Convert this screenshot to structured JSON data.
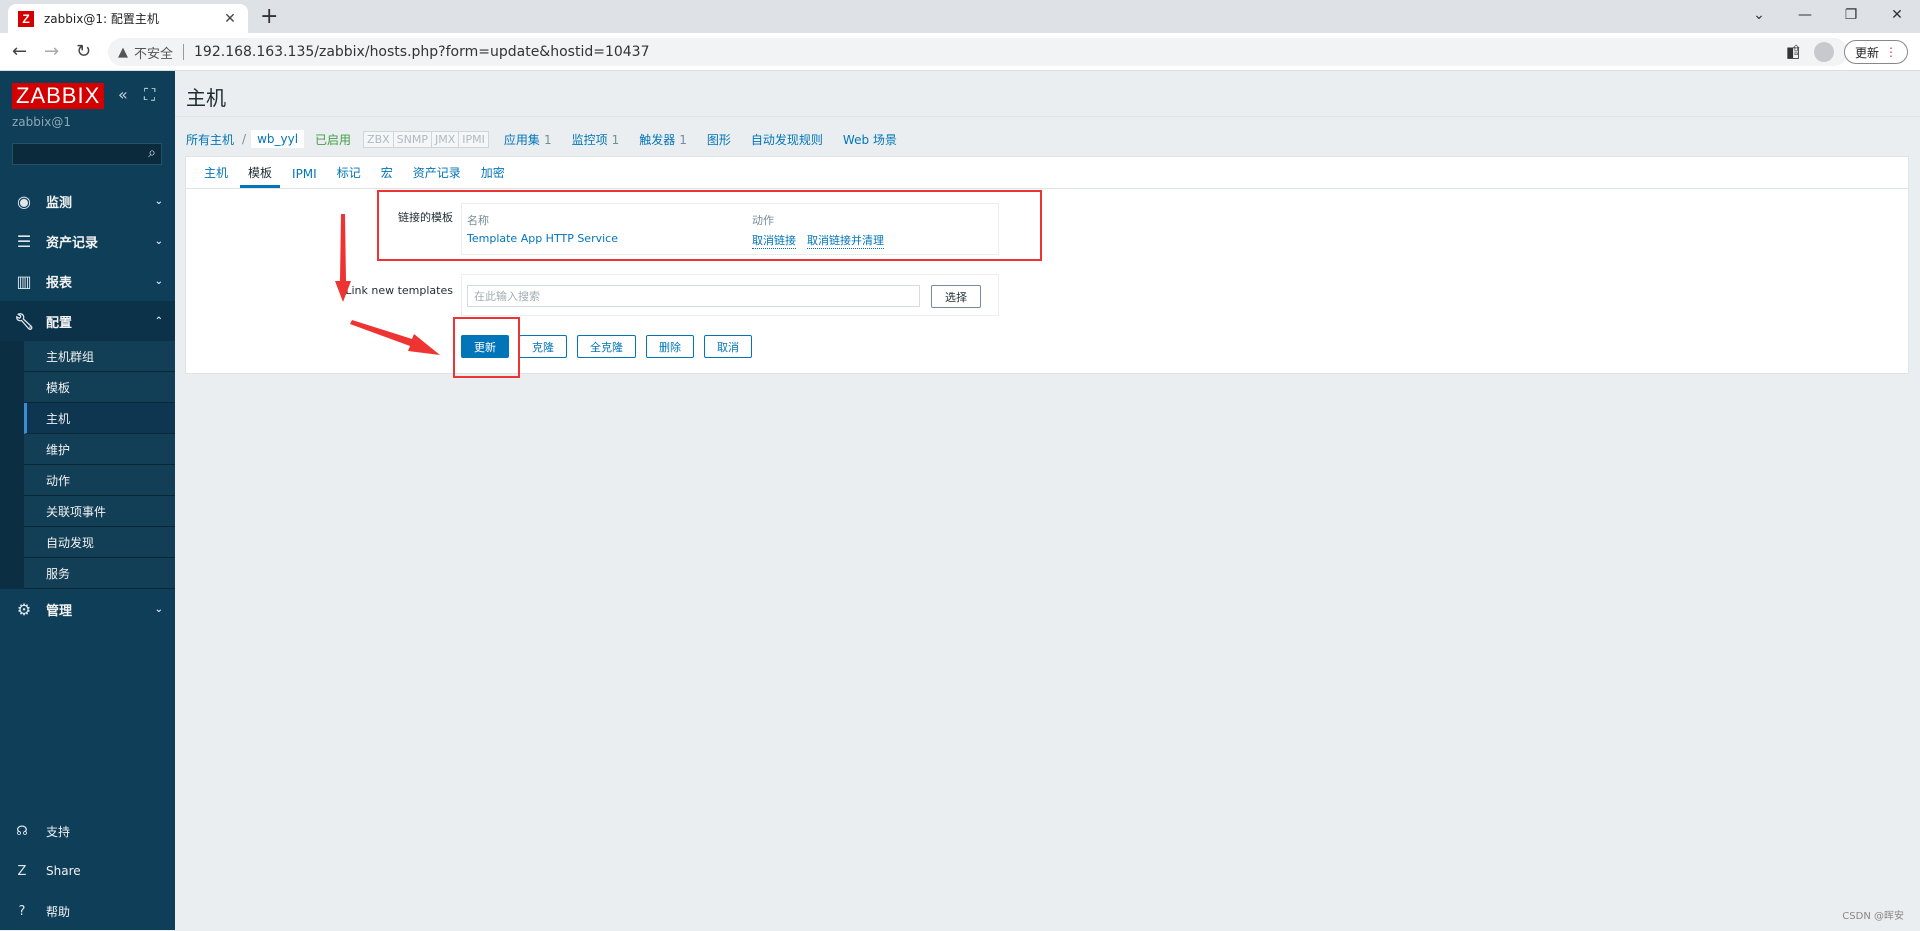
{
  "browser": {
    "tab_title": "zabbix@1: 配置主机",
    "favicon_letter": "Z",
    "insecure_label": "不安全",
    "url": "192.168.163.135/zabbix/hosts.php?form=update&hostid=10437",
    "update_label": "更新"
  },
  "sidebar": {
    "logo": "ZABBIX",
    "user": "zabbix@1",
    "menu": [
      {
        "label": "监测",
        "icon": "eye-icon"
      },
      {
        "label": "资产记录",
        "icon": "list-icon"
      },
      {
        "label": "报表",
        "icon": "chart-icon"
      },
      {
        "label": "配置",
        "icon": "wrench-icon"
      }
    ],
    "submenu": [
      "主机群组",
      "模板",
      "主机",
      "维护",
      "动作",
      "关联项事件",
      "自动发现",
      "服务"
    ],
    "admin": {
      "label": "管理",
      "icon": "gear-icon"
    },
    "bottom": [
      {
        "label": "支持",
        "icon": "headset-icon"
      },
      {
        "label": "Share",
        "icon": "zabbix-share-icon"
      },
      {
        "label": "帮助",
        "icon": "question-icon"
      }
    ]
  },
  "main": {
    "title": "主机",
    "breadcrumbs": {
      "all_hosts": "所有主机",
      "separator": "/",
      "current": "wb_yyl",
      "status": "已启用",
      "availability": [
        "ZBX",
        "SNMP",
        "JMX",
        "IPMI"
      ],
      "links": [
        {
          "label": "应用集",
          "count": "1"
        },
        {
          "label": "监控项",
          "count": "1"
        },
        {
          "label": "触发器",
          "count": "1"
        },
        {
          "label": "图形",
          "count": ""
        },
        {
          "label": "自动发现规则",
          "count": ""
        },
        {
          "label": "Web 场景",
          "count": ""
        }
      ]
    },
    "tabs": [
      "主机",
      "模板",
      "IPMI",
      "标记",
      "宏",
      "资产记录",
      "加密"
    ],
    "selected_tab": "模板",
    "linked_templates": {
      "label": "链接的模板",
      "col_name": "名称",
      "col_action": "动作",
      "rows": [
        {
          "name": "Template App HTTP Service",
          "unlink": "取消链接",
          "unlink_clear": "取消链接并清理"
        }
      ]
    },
    "new_templates": {
      "label": "Link new templates",
      "placeholder": "在此输入搜索",
      "choose": "选择"
    },
    "buttons": {
      "update": "更新",
      "clone": "克隆",
      "full_clone": "全克隆",
      "delete": "删除",
      "cancel": "取消"
    }
  },
  "watermark": "CSDN @晖安",
  "colors": {
    "sidebar_bg": "#0e3e58",
    "accent": "#0275b8",
    "annotation_red": "#e33333",
    "logo_red": "#d40000"
  }
}
